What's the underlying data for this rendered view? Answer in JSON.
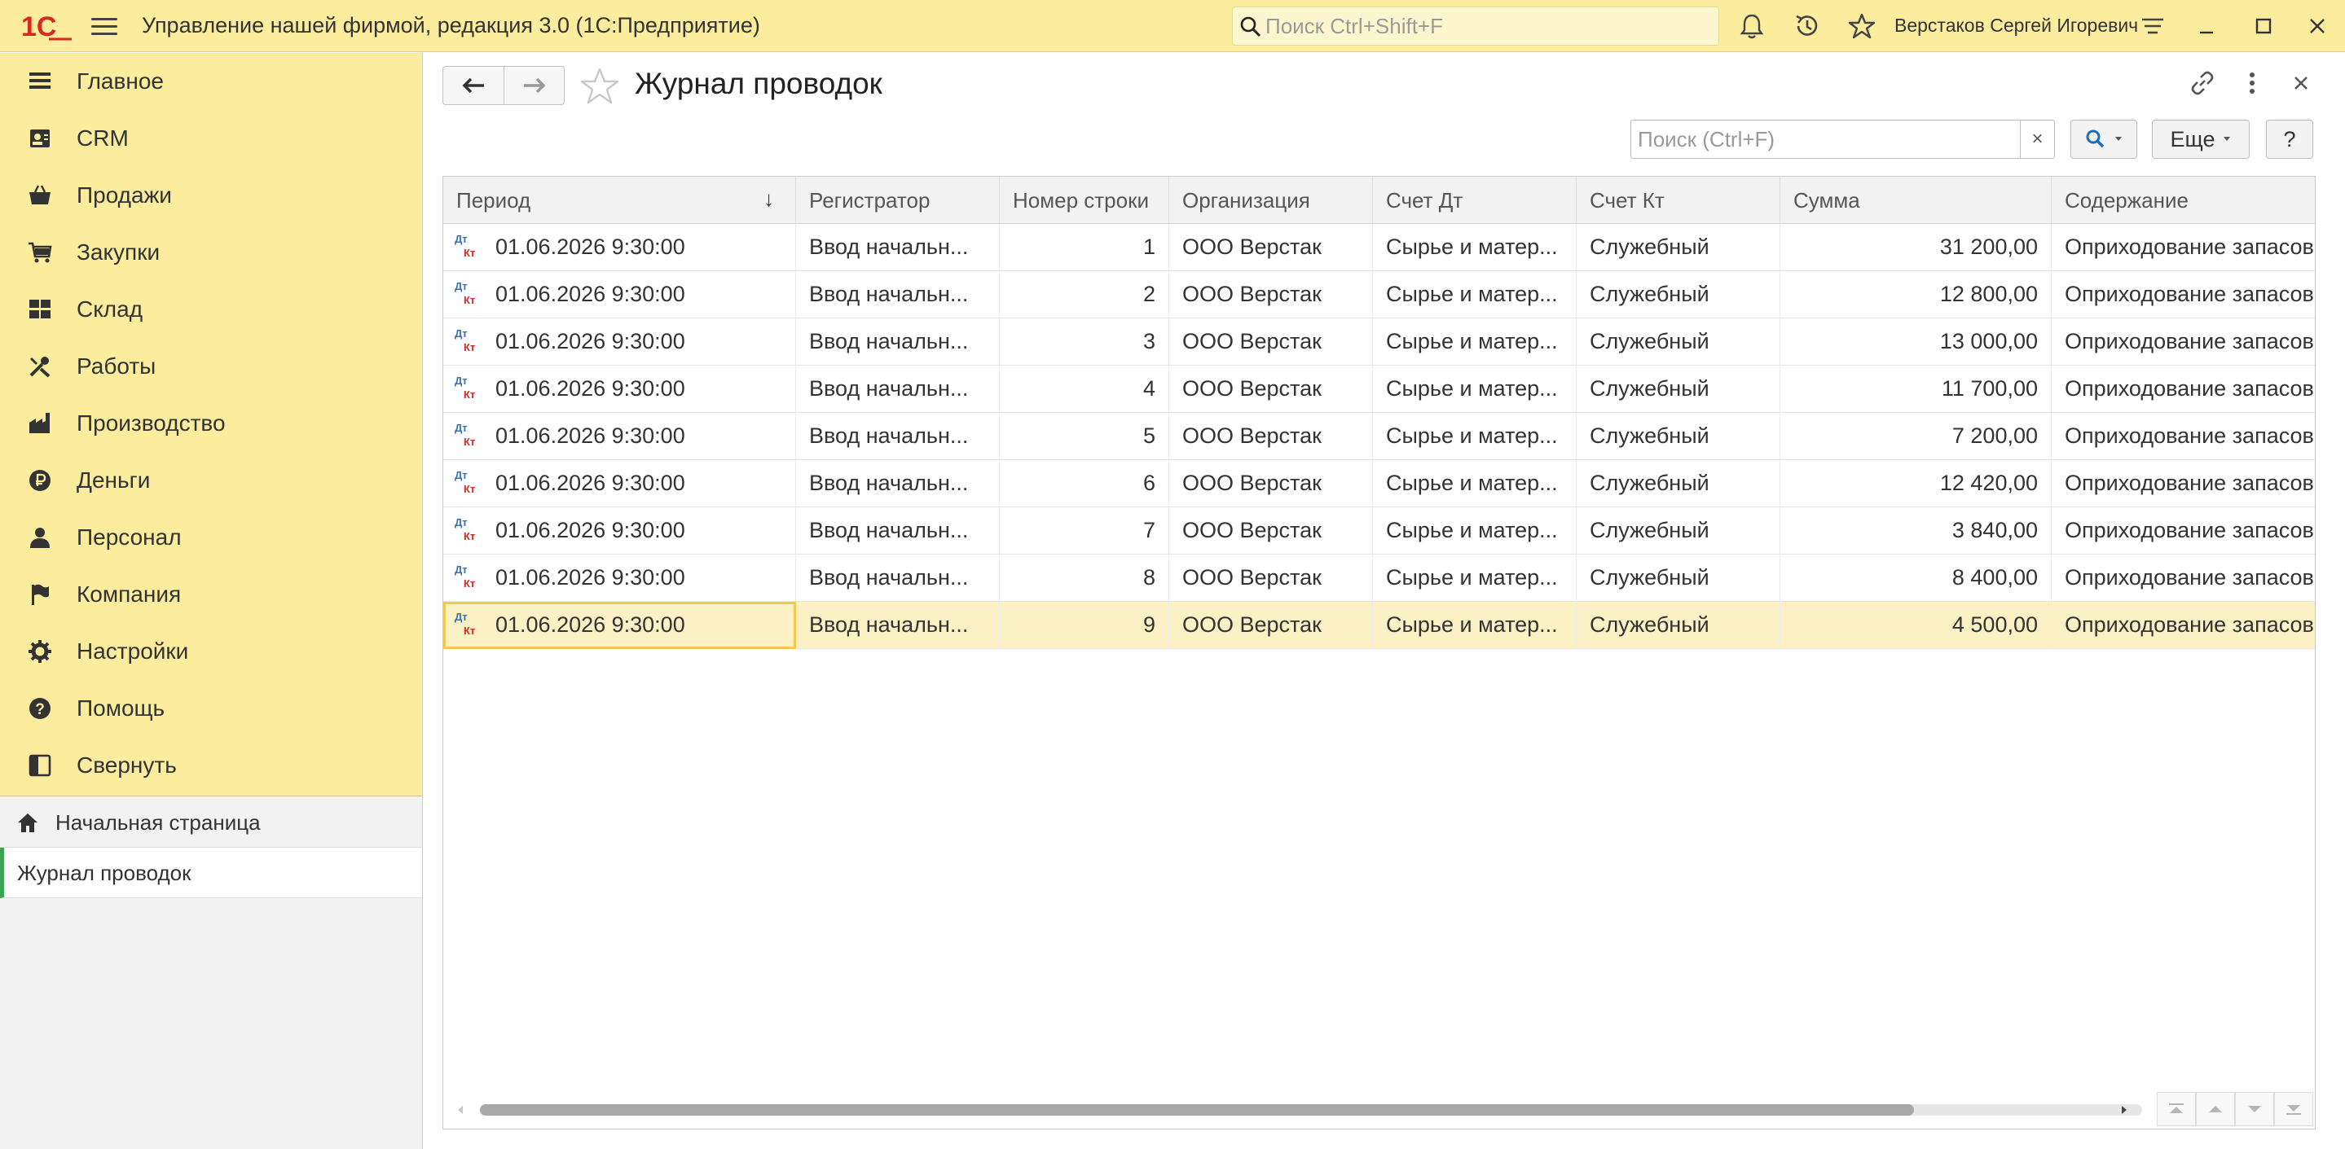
{
  "app": {
    "logo_text": "1С",
    "title": "Управление нашей фирмой, редакция 3.0  (1С:Предприятие)",
    "search_placeholder": "Поиск Ctrl+Shift+F",
    "user": "Верстаков Сергей Игоревич"
  },
  "colors": {
    "accent_yellow": "#fbec9e",
    "selected_row": "#fbf1c4",
    "active_marker": "#3da551",
    "logo_red": "#d42a21"
  },
  "sidebar": {
    "sections": [
      {
        "label": "Главное",
        "icon": "list-icon"
      },
      {
        "label": "CRM",
        "icon": "contacts-icon"
      },
      {
        "label": "Продажи",
        "icon": "basket-icon"
      },
      {
        "label": "Закупки",
        "icon": "cart-icon"
      },
      {
        "label": "Склад",
        "icon": "warehouse-icon"
      },
      {
        "label": "Работы",
        "icon": "tools-icon"
      },
      {
        "label": "Производство",
        "icon": "factory-icon"
      },
      {
        "label": "Деньги",
        "icon": "ruble-icon"
      },
      {
        "label": "Персонал",
        "icon": "person-icon"
      },
      {
        "label": "Компания",
        "icon": "flag-icon"
      },
      {
        "label": "Настройки",
        "icon": "gear-icon"
      },
      {
        "label": "Помощь",
        "icon": "help-icon"
      },
      {
        "label": "Свернуть",
        "icon": "collapse-icon"
      }
    ],
    "open_windows": [
      {
        "label": "Начальная страница"
      },
      {
        "label": "Журнал проводок"
      }
    ]
  },
  "form": {
    "title": "Журнал проводок",
    "search_placeholder": "Поиск (Ctrl+F)",
    "clear_label": "×",
    "more_label": "Еще",
    "help_label": "?"
  },
  "table": {
    "columns": [
      "Период",
      "Регистратор",
      "Номер строки",
      "Организация",
      "Счет Дт",
      "Счет Кт",
      "Сумма",
      "Содержание"
    ],
    "icon_text_dt": "Дт",
    "icon_text_kt": "Кт",
    "rows": [
      {
        "period": "01.06.2026 9:30:00",
        "registrar": "Ввод начальн...",
        "line": "1",
        "org": "ООО Верстак",
        "dt": "Сырье и матер...",
        "kt": "Служебный",
        "sum": "31 200,00",
        "content": "Оприходование запасов"
      },
      {
        "period": "01.06.2026 9:30:00",
        "registrar": "Ввод начальн...",
        "line": "2",
        "org": "ООО Верстак",
        "dt": "Сырье и матер...",
        "kt": "Служебный",
        "sum": "12 800,00",
        "content": "Оприходование запасов"
      },
      {
        "period": "01.06.2026 9:30:00",
        "registrar": "Ввод начальн...",
        "line": "3",
        "org": "ООО Верстак",
        "dt": "Сырье и матер...",
        "kt": "Служебный",
        "sum": "13 000,00",
        "content": "Оприходование запасов"
      },
      {
        "period": "01.06.2026 9:30:00",
        "registrar": "Ввод начальн...",
        "line": "4",
        "org": "ООО Верстак",
        "dt": "Сырье и матер...",
        "kt": "Служебный",
        "sum": "11 700,00",
        "content": "Оприходование запасов"
      },
      {
        "period": "01.06.2026 9:30:00",
        "registrar": "Ввод начальн...",
        "line": "5",
        "org": "ООО Верстак",
        "dt": "Сырье и матер...",
        "kt": "Служебный",
        "sum": "7 200,00",
        "content": "Оприходование запасов"
      },
      {
        "period": "01.06.2026 9:30:00",
        "registrar": "Ввод начальн...",
        "line": "6",
        "org": "ООО Верстак",
        "dt": "Сырье и матер...",
        "kt": "Служебный",
        "sum": "12 420,00",
        "content": "Оприходование запасов"
      },
      {
        "period": "01.06.2026 9:30:00",
        "registrar": "Ввод начальн...",
        "line": "7",
        "org": "ООО Верстак",
        "dt": "Сырье и матер...",
        "kt": "Служебный",
        "sum": "3 840,00",
        "content": "Оприходование запасов"
      },
      {
        "period": "01.06.2026 9:30:00",
        "registrar": "Ввод начальн...",
        "line": "8",
        "org": "ООО Верстак",
        "dt": "Сырье и матер...",
        "kt": "Служебный",
        "sum": "8 400,00",
        "content": "Оприходование запасов"
      },
      {
        "period": "01.06.2026 9:30:00",
        "registrar": "Ввод начальн...",
        "line": "9",
        "org": "ООО Верстак",
        "dt": "Сырье и матер...",
        "kt": "Служебный",
        "sum": "4 500,00",
        "content": "Оприходование запасов"
      }
    ],
    "selected_row": 9
  }
}
